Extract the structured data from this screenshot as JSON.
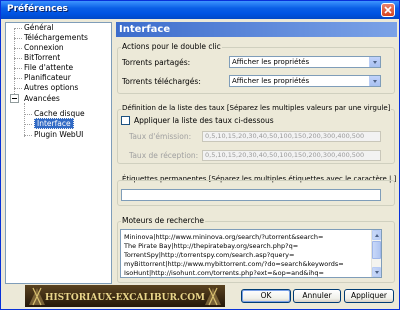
{
  "window": {
    "title": "Préférences"
  },
  "tree": {
    "items": [
      {
        "label": "Général"
      },
      {
        "label": "Téléchargements"
      },
      {
        "label": "Connexion"
      },
      {
        "label": "BitTorrent"
      },
      {
        "label": "File d'attente"
      },
      {
        "label": "Planificateur"
      },
      {
        "label": "Autres options"
      },
      {
        "label": "Avancées"
      },
      {
        "label": "Cache disque"
      },
      {
        "label": "Interface"
      },
      {
        "label": "Plugin WebUI"
      }
    ],
    "selected_index": 9
  },
  "panel": {
    "title": "Interface"
  },
  "double_click": {
    "group_title": "Actions pour le double clic",
    "shared_label": "Torrents partagés:",
    "shared_value": "Afficher les propriétés",
    "downloaded_label": "Torrents téléchargés:",
    "downloaded_value": "Afficher les propriétés"
  },
  "rates": {
    "group_title": "Définition de la liste des taux [Séparez les multiples valeurs par une virgule]",
    "checkbox_label": "Appliquer la liste des taux ci-dessous",
    "checked": false,
    "upload_label": "Taux d'émission:",
    "upload_value": "0,5,10,15,20,30,40,50,100,150,200,300,400,500",
    "download_label": "Taux de réception:",
    "download_value": "0,5,10,15,20,30,40,50,100,150,200,300,400,500"
  },
  "labels": {
    "group_title": "Étiquettes permanentes [Séparez les multiples étiquettes avec le caractère | ]",
    "value": ""
  },
  "search": {
    "group_title": "Moteurs de recherche",
    "lines": [
      "Mininova|http://www.mininova.org/search/?utorrent&search=",
      "The Pirate Bay|http://thepiratebay.org/search.php?q=",
      "TorrentSpy|http://torrentspy.com/search.asp?query=",
      "myBittorrent|http://www.mybittorrent.com/?do=search&keywords=",
      "IsoHunt|http://isohunt.com/torrents.php?ext=&op=and&ihq="
    ]
  },
  "buttons": {
    "ok": "OK",
    "cancel": "Annuler",
    "apply": "Appliquer"
  },
  "banner": {
    "text": "HISTORIAUX-EXCALIBUR.COM"
  },
  "colors": {
    "titlebar": "#0054e3",
    "header": "#3d6dcc",
    "selection": "#316ac5"
  }
}
